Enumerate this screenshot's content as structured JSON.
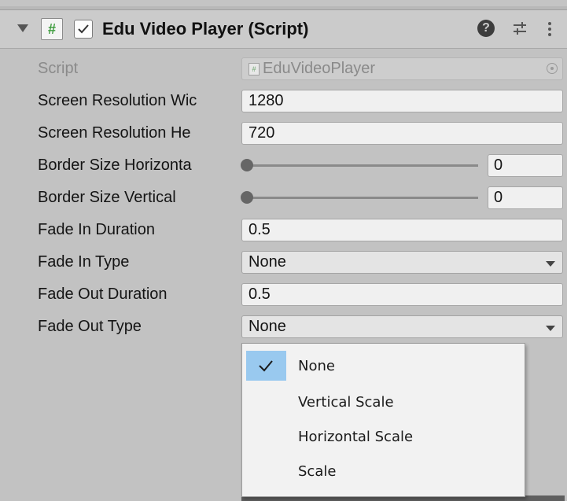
{
  "component": {
    "title": "Edu Video Player (Script)",
    "enabled": true,
    "icons": [
      "foldout-arrow",
      "script-icon",
      "help-icon",
      "preset-icon",
      "menu-icon"
    ]
  },
  "fields": {
    "script": {
      "label": "Script",
      "value": "EduVideoPlayer"
    },
    "screen_width": {
      "label": "Screen Resolution Wic",
      "value": "1280"
    },
    "screen_height": {
      "label": "Screen Resolution He",
      "value": "720"
    },
    "border_h": {
      "label": "Border Size Horizonta",
      "value": "0"
    },
    "border_v": {
      "label": "Border Size Vertical",
      "value": "0"
    },
    "fade_in_duration": {
      "label": "Fade In Duration",
      "value": "0.5"
    },
    "fade_in_type": {
      "label": "Fade In Type",
      "value": "None"
    },
    "fade_out_duration": {
      "label": "Fade Out Duration",
      "value": "0.5"
    },
    "fade_out_type": {
      "label": "Fade Out Type",
      "value": "None"
    }
  },
  "popup": {
    "selected": "None",
    "options": [
      "None",
      "Vertical Scale",
      "Horizontal Scale",
      "Scale"
    ]
  },
  "colors": {
    "panel_bg": "#c2c2c2",
    "field_bg": "#f0f0f0",
    "popup_bg": "#f2f2f2",
    "selection": "#99c9ef"
  }
}
